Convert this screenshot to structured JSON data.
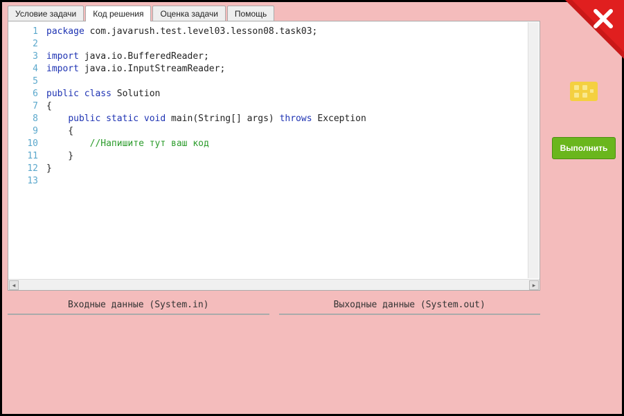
{
  "tabs": [
    {
      "label": "Условие задачи"
    },
    {
      "label": "Код решения"
    },
    {
      "label": "Оценка задачи"
    },
    {
      "label": "Помощь"
    }
  ],
  "active_tab": 1,
  "code_lines": [
    {
      "n": 1,
      "html": "<span class='kw'>package</span> <span class='pkg'>com.javarush.test.level03.lesson08.task03;</span>"
    },
    {
      "n": 2,
      "html": ""
    },
    {
      "n": 3,
      "html": "<span class='kw'>import</span> java.io.BufferedReader;"
    },
    {
      "n": 4,
      "html": "<span class='kw'>import</span> java.io.InputStreamReader;"
    },
    {
      "n": 5,
      "html": ""
    },
    {
      "n": 6,
      "html": "<span class='kw'>public class</span> Solution"
    },
    {
      "n": 7,
      "html": "{"
    },
    {
      "n": 8,
      "html": "    <span class='kw'>public static void</span> main(String[] args) <span class='kw'>throws</span> Exception"
    },
    {
      "n": 9,
      "html": "    {"
    },
    {
      "n": 10,
      "html": "        <span class='cm'>//Напишите тут ваш код</span>"
    },
    {
      "n": 11,
      "html": "    }"
    },
    {
      "n": 12,
      "html": "}"
    },
    {
      "n": 13,
      "html": ""
    }
  ],
  "io": {
    "input_label": "Входные данные (System.in)",
    "output_label": "Выходные данные (System.out)"
  },
  "run_button": "Выполнить"
}
